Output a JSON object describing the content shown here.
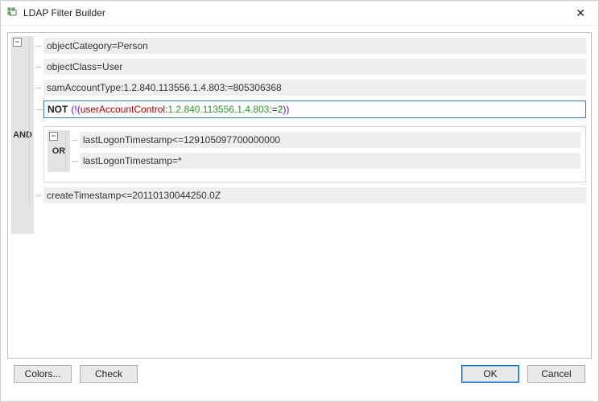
{
  "window": {
    "title": "LDAP Filter Builder",
    "close_label": "✕"
  },
  "ops": {
    "root": "AND",
    "nested": "OR",
    "not": "NOT"
  },
  "rows": {
    "r1": "objectCategory=Person",
    "r2": "objectClass=User",
    "r3": "samAccountType:1.2.840.113556.1.4.803:=805306368",
    "r4_paren_open": "(",
    "r4_bang": "!",
    "r4_paren2_open": "(",
    "r4_attr": "userAccountControl",
    "r4_colon": ":",
    "r4_oid": "1.2.840.113556.1.4.803",
    "r4_colon2": ":",
    "r4_eq": "=",
    "r4_val": "2",
    "r4_paren2_close": ")",
    "r4_paren_close": ")",
    "r5": "lastLogonTimestamp<=129105097700000000",
    "r6": "lastLogonTimestamp=*",
    "r7": "createTimestamp<=20110130044250.0Z"
  },
  "buttons": {
    "colors": "Colors...",
    "check": "Check",
    "ok": "OK",
    "cancel": "Cancel"
  },
  "toggle": {
    "minus": "−"
  }
}
